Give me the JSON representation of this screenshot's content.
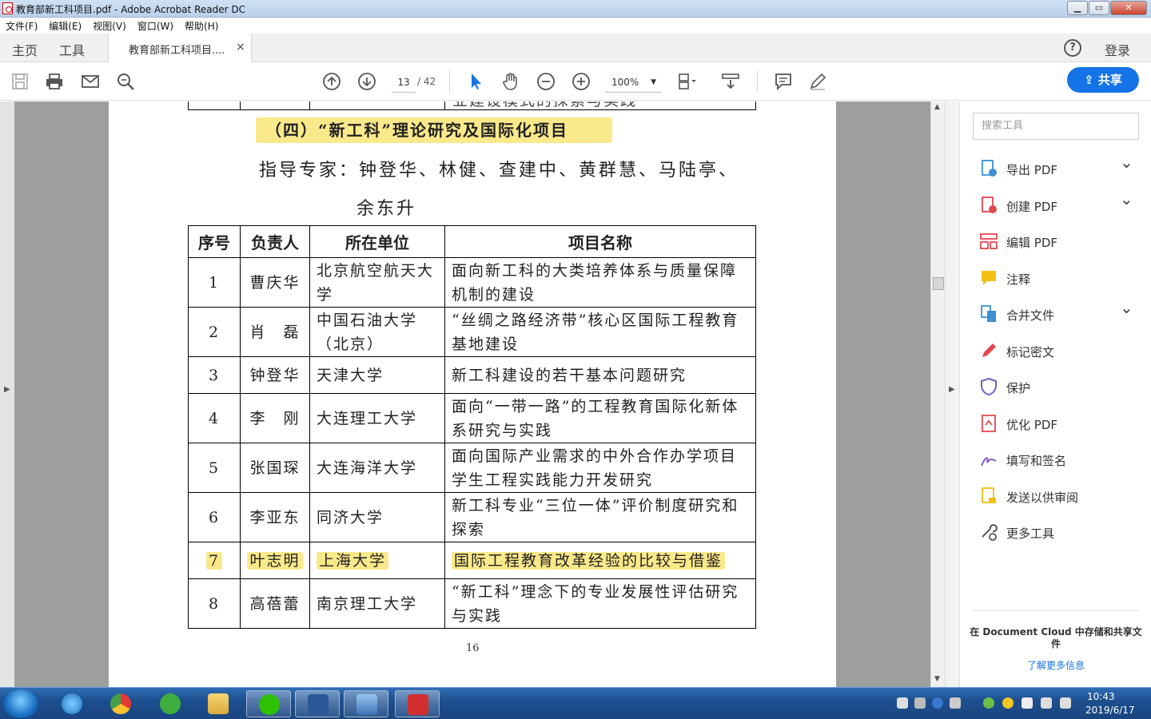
{
  "window": {
    "title": "教育部新工科项目.pdf - Adobe Acrobat Reader DC",
    "minimize": "▁",
    "maximize": "▭",
    "close": "✕"
  },
  "menu": [
    "文件(F)",
    "编辑(E)",
    "视图(V)",
    "窗口(W)",
    "帮助(H)"
  ],
  "tabs": {
    "home": "主页",
    "tools": "工具",
    "document": "教育部新工科项目....",
    "close": "×"
  },
  "header": {
    "help": "?",
    "login": "登录"
  },
  "toolbar": {
    "page_current": "13",
    "page_total": "/ 42",
    "zoom": "100%",
    "share": "共享"
  },
  "document": {
    "prev_row_text": "业建设模式的探索与实践",
    "section_heading": "（四）“新工科”理论研究及国际化项目",
    "experts_line1": "指导专家：钟登华、林健、查建中、黄群慧、马陆亭、",
    "experts_line2": "余东升",
    "columns": [
      "序号",
      "负责人",
      "所在单位",
      "项目名称"
    ],
    "rows": [
      {
        "no": "1",
        "leader": "曹庆华",
        "unit": "北京航空航天大学",
        "project": "面向新工科的大类培养体系与质量保障机制的建设",
        "highlight": false
      },
      {
        "no": "2",
        "leader": "肖　磊",
        "unit": "中国石油大学（北京）",
        "project": "“丝绸之路经济带”核心区国际工程教育基地建设",
        "highlight": false
      },
      {
        "no": "3",
        "leader": "钟登华",
        "unit": "天津大学",
        "project": "新工科建设的若干基本问题研究",
        "highlight": false
      },
      {
        "no": "4",
        "leader": "李　刚",
        "unit": "大连理工大学",
        "project": "面向“一带一路”的工程教育国际化新体系研究与实践",
        "highlight": false
      },
      {
        "no": "5",
        "leader": "张国琛",
        "unit": "大连海洋大学",
        "project": "面向国际产业需求的中外合作办学项目学生工程实践能力开发研究",
        "highlight": false
      },
      {
        "no": "6",
        "leader": "李亚东",
        "unit": "同济大学",
        "project": "新工科专业“三位一体”评价制度研究和探索",
        "highlight": false
      },
      {
        "no": "7",
        "leader": "叶志明",
        "unit": "上海大学",
        "project": "国际工程教育改革经验的比较与借鉴",
        "highlight": true
      },
      {
        "no": "8",
        "leader": "高蓓蕾",
        "unit": "南京理工大学",
        "project": "“新工科”理念下的专业发展性评估研究与实践",
        "highlight": false
      }
    ],
    "page_number": "16"
  },
  "tools_pane": {
    "search_placeholder": "搜索工具",
    "items": [
      {
        "label": "导出 PDF",
        "icon": "export-pdf-icon",
        "color": "#3d8fd1",
        "expand": true
      },
      {
        "label": "创建 PDF",
        "icon": "create-pdf-icon",
        "color": "#e34850",
        "expand": true
      },
      {
        "label": "编辑 PDF",
        "icon": "edit-pdf-icon",
        "color": "#e34850",
        "expand": false
      },
      {
        "label": "注释",
        "icon": "comment-icon",
        "color": "#f2c014",
        "expand": false
      },
      {
        "label": "合并文件",
        "icon": "combine-files-icon",
        "color": "#3d8fd1",
        "expand": true
      },
      {
        "label": "标记密文",
        "icon": "redact-icon",
        "color": "#e34850",
        "expand": false
      },
      {
        "label": "保护",
        "icon": "protect-icon",
        "color": "#6c5fc7",
        "expand": false
      },
      {
        "label": "优化 PDF",
        "icon": "optimize-pdf-icon",
        "color": "#e34850",
        "expand": false
      },
      {
        "label": "填写和签名",
        "icon": "fill-sign-icon",
        "color": "#7f5ccf",
        "expand": false
      },
      {
        "label": "发送以供审阅",
        "icon": "send-review-icon",
        "color": "#f2c014",
        "expand": false
      },
      {
        "label": "更多工具",
        "icon": "more-tools-icon",
        "color": "#555555",
        "expand": false
      }
    ],
    "doc_cloud_text": "在 Document Cloud 中存储和共享文件",
    "doc_cloud_link": "了解更多信息"
  },
  "taskbar": {
    "time": "10:43",
    "date": "2019/6/17"
  }
}
